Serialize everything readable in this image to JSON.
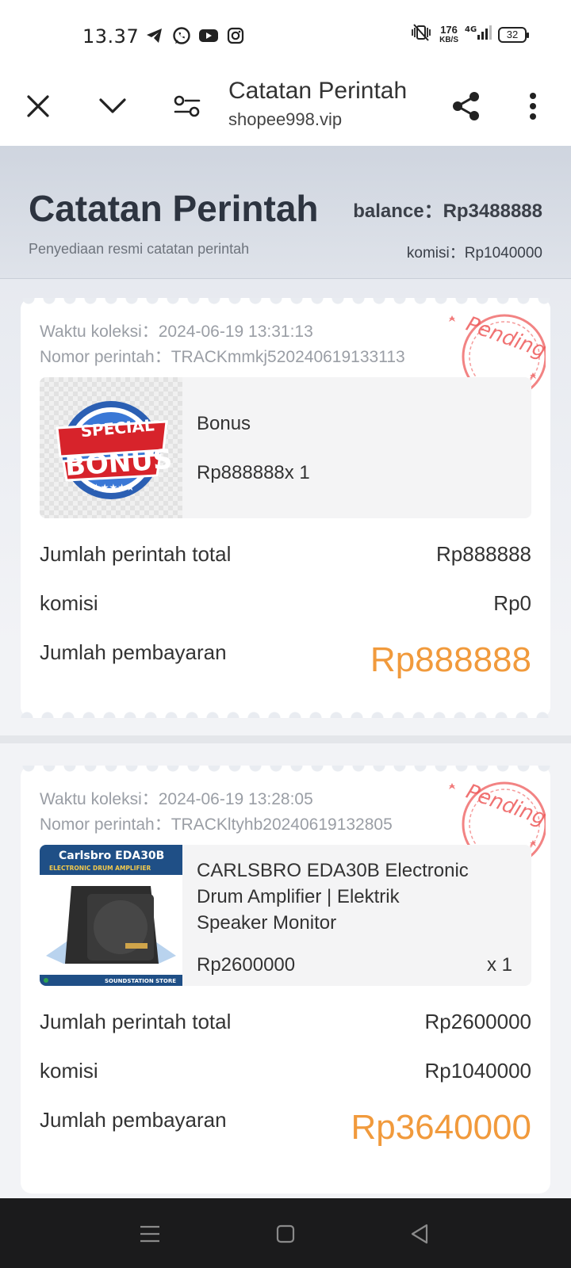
{
  "status_bar": {
    "time": "13.37",
    "net_speed": "176",
    "net_speed_unit": "KB/S",
    "network": "4G",
    "battery": "32",
    "app_icons": [
      "telegram-icon",
      "whatsapp-icon",
      "youtube-icon",
      "instagram-icon"
    ]
  },
  "browser": {
    "title": "Catatan Perintah",
    "url": "shopee998.vip"
  },
  "header": {
    "title": "Catatan Perintah",
    "subtitle": "Penyediaan resmi catatan perintah",
    "balance": "balance：Rp3488888",
    "komisi": "komisi：Rp1040000"
  },
  "orders": [
    {
      "time": "Waktu koleksi：2024-06-19 13:31:13",
      "order_no": "Nomor perintah：TRACKmmkj520240619133113",
      "status": "Pending",
      "product_name": "Bonus",
      "product_price": "Rp888888x 1",
      "image_text": [
        "SPECIAL",
        "BONUS"
      ],
      "total_label": "Jumlah perintah total",
      "total_value": "Rp888888",
      "komisi_label": "komisi",
      "komisi_value": "Rp0",
      "pay_label": "Jumlah pembayaran",
      "pay_value": "Rp888888"
    },
    {
      "time": "Waktu koleksi：2024-06-19 13:28:05",
      "order_no": "Nomor perintah：TRACKltyhb20240619132805",
      "status": "Pending",
      "product_name_lines": [
        "CARLSBRO EDA30B Electronic",
        "Drum Amplifier | Elektrik",
        "Speaker Monitor"
      ],
      "product_price": "Rp2600000",
      "product_qty": "x 1",
      "image_text": [
        "Carlsbro EDA30B",
        "ELECTRONIC DRUM AMPLIFIER",
        "SOUNDSTATION STORE"
      ],
      "total_label": "Jumlah perintah total",
      "total_value": "Rp2600000",
      "komisi_label": "komisi",
      "komisi_value": "Rp1040000",
      "pay_label": "Jumlah pembayaran",
      "pay_value": "Rp3640000"
    }
  ],
  "colors": {
    "accent_orange": "#f19a3c",
    "stamp_red": "#ee5a5a"
  }
}
